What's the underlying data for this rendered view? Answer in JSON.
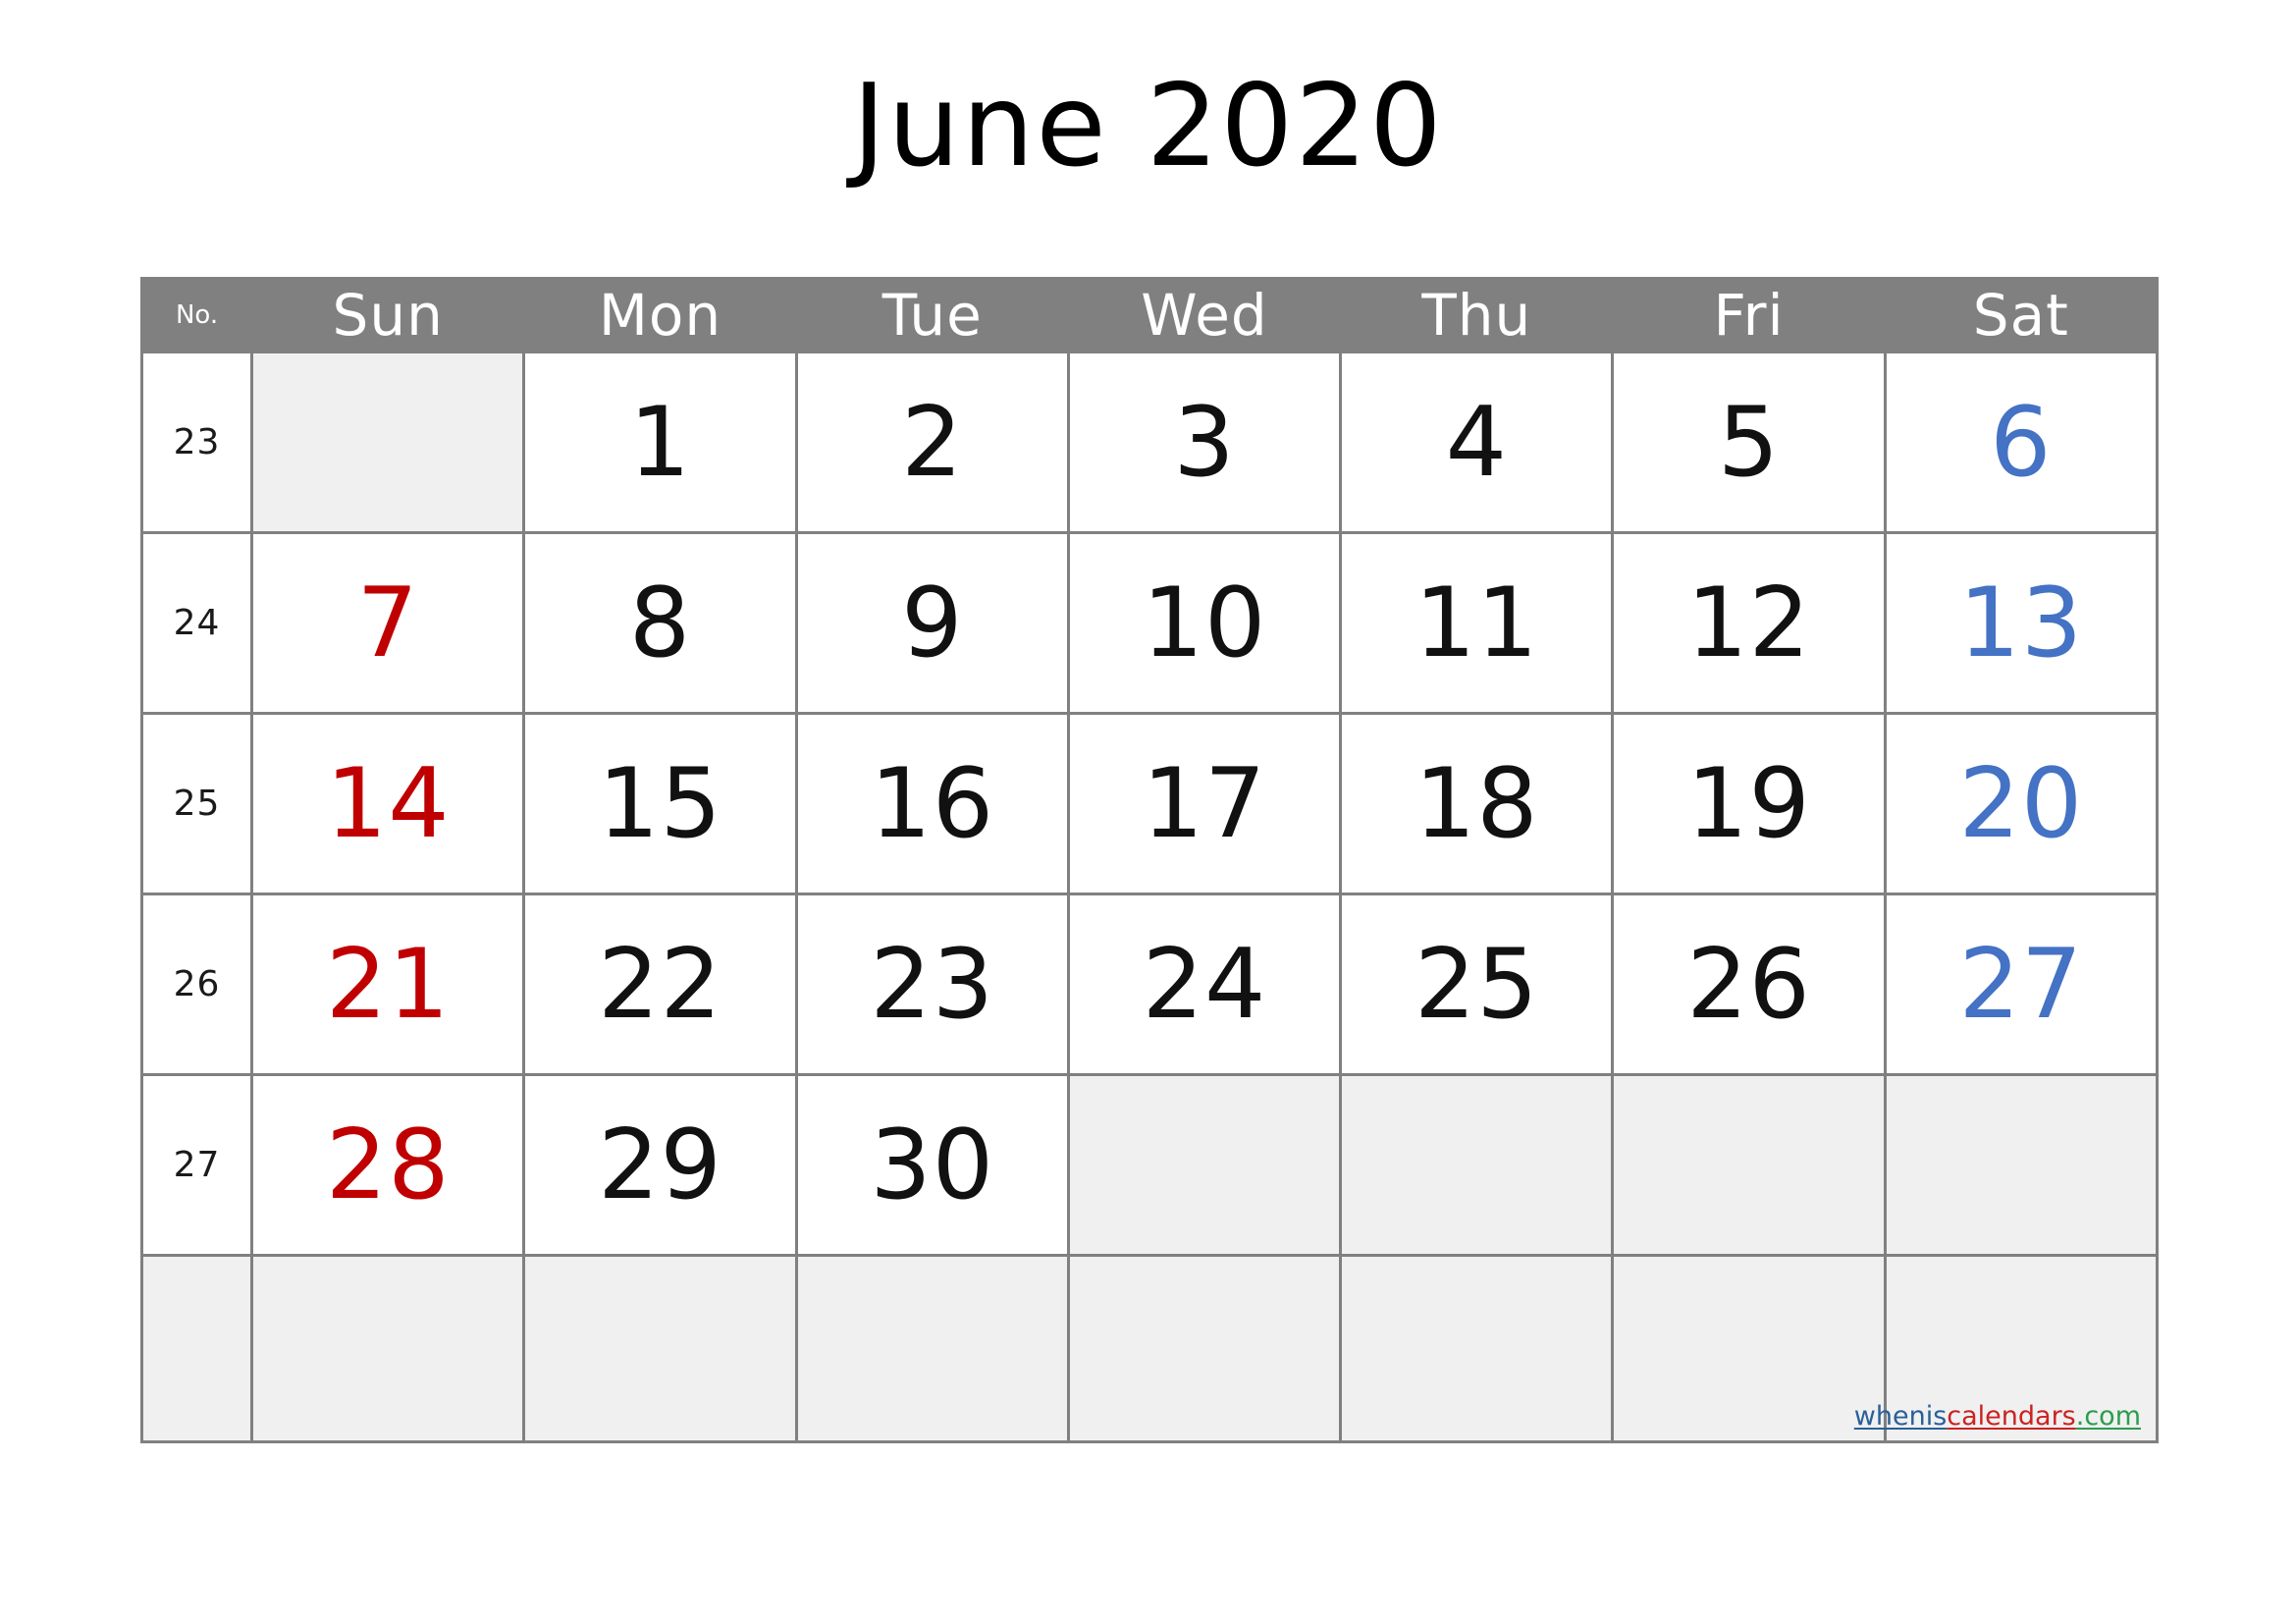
{
  "title": "June 2020",
  "header": {
    "week_number_label": "No.",
    "days": [
      "Sun",
      "Mon",
      "Tue",
      "Wed",
      "Thu",
      "Fri",
      "Sat"
    ]
  },
  "colors": {
    "header_bg": "#808080",
    "header_text": "#ffffff",
    "grid_line": "#808080",
    "cell_bg": "#ffffff",
    "inactive_cell_bg": "#f0f0f0",
    "weekday_text": "#111111",
    "sunday_text": "#c00000",
    "saturday_text": "#4472c4",
    "week_number_text": "#1a1a1a"
  },
  "weeks": [
    {
      "number": "23",
      "days": [
        {
          "label": "",
          "type": "off"
        },
        {
          "label": "1",
          "type": "wk"
        },
        {
          "label": "2",
          "type": "wk"
        },
        {
          "label": "3",
          "type": "wk"
        },
        {
          "label": "4",
          "type": "wk"
        },
        {
          "label": "5",
          "type": "wk"
        },
        {
          "label": "6",
          "type": "sat"
        }
      ]
    },
    {
      "number": "24",
      "days": [
        {
          "label": "7",
          "type": "sun"
        },
        {
          "label": "8",
          "type": "wk"
        },
        {
          "label": "9",
          "type": "wk"
        },
        {
          "label": "10",
          "type": "wk"
        },
        {
          "label": "11",
          "type": "wk"
        },
        {
          "label": "12",
          "type": "wk"
        },
        {
          "label": "13",
          "type": "sat"
        }
      ]
    },
    {
      "number": "25",
      "days": [
        {
          "label": "14",
          "type": "sun"
        },
        {
          "label": "15",
          "type": "wk"
        },
        {
          "label": "16",
          "type": "wk"
        },
        {
          "label": "17",
          "type": "wk"
        },
        {
          "label": "18",
          "type": "wk"
        },
        {
          "label": "19",
          "type": "wk"
        },
        {
          "label": "20",
          "type": "sat"
        }
      ]
    },
    {
      "number": "26",
      "days": [
        {
          "label": "21",
          "type": "sun"
        },
        {
          "label": "22",
          "type": "wk"
        },
        {
          "label": "23",
          "type": "wk"
        },
        {
          "label": "24",
          "type": "wk"
        },
        {
          "label": "25",
          "type": "wk"
        },
        {
          "label": "26",
          "type": "wk"
        },
        {
          "label": "27",
          "type": "sat"
        }
      ]
    },
    {
      "number": "27",
      "days": [
        {
          "label": "28",
          "type": "sun"
        },
        {
          "label": "29",
          "type": "wk"
        },
        {
          "label": "30",
          "type": "wk"
        },
        {
          "label": "",
          "type": "off"
        },
        {
          "label": "",
          "type": "off"
        },
        {
          "label": "",
          "type": "off"
        },
        {
          "label": "",
          "type": "off"
        }
      ]
    },
    {
      "number": "",
      "days": [
        {
          "label": "",
          "type": "off"
        },
        {
          "label": "",
          "type": "off"
        },
        {
          "label": "",
          "type": "off"
        },
        {
          "label": "",
          "type": "off"
        },
        {
          "label": "",
          "type": "off"
        },
        {
          "label": "",
          "type": "off"
        },
        {
          "label": "",
          "type": "off"
        }
      ]
    }
  ],
  "watermark": {
    "part1": "whenis",
    "part2": "calendars",
    "part3": ".com"
  }
}
